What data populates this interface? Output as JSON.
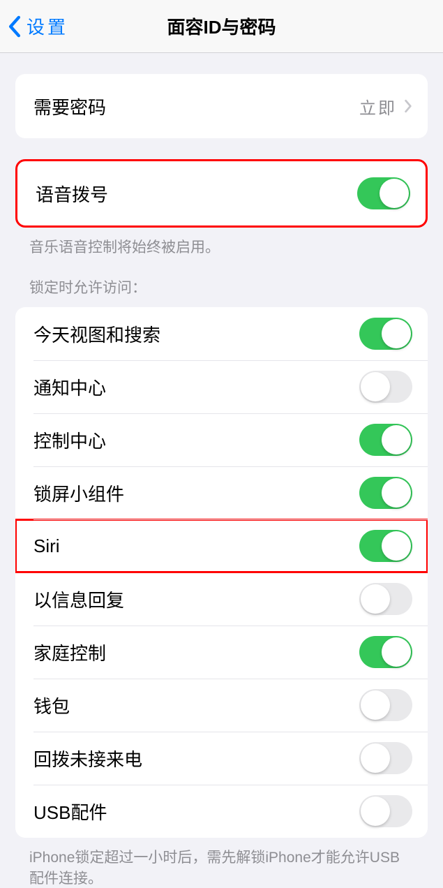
{
  "header": {
    "back_label": "设置",
    "title": "面容ID与密码"
  },
  "require_passcode": {
    "label": "需要密码",
    "value": "立即"
  },
  "voice_dial": {
    "label": "语音拨号",
    "enabled": true,
    "footer": "音乐语音控制将始终被启用。"
  },
  "locked_access": {
    "header": "锁定时允许访问：",
    "items": [
      {
        "label": "今天视图和搜索",
        "enabled": true
      },
      {
        "label": "通知中心",
        "enabled": false
      },
      {
        "label": "控制中心",
        "enabled": true
      },
      {
        "label": "锁屏小组件",
        "enabled": true
      },
      {
        "label": "Siri",
        "enabled": true
      },
      {
        "label": "以信息回复",
        "enabled": false
      },
      {
        "label": "家庭控制",
        "enabled": true
      },
      {
        "label": "钱包",
        "enabled": false
      },
      {
        "label": "回拨未接来电",
        "enabled": false
      },
      {
        "label": "USB配件",
        "enabled": false
      }
    ],
    "footer": "iPhone锁定超过一小时后，需先解锁iPhone才能允许USB配件连接。"
  },
  "highlighted_rows": [
    "voice_dial_group",
    "row-siri"
  ]
}
